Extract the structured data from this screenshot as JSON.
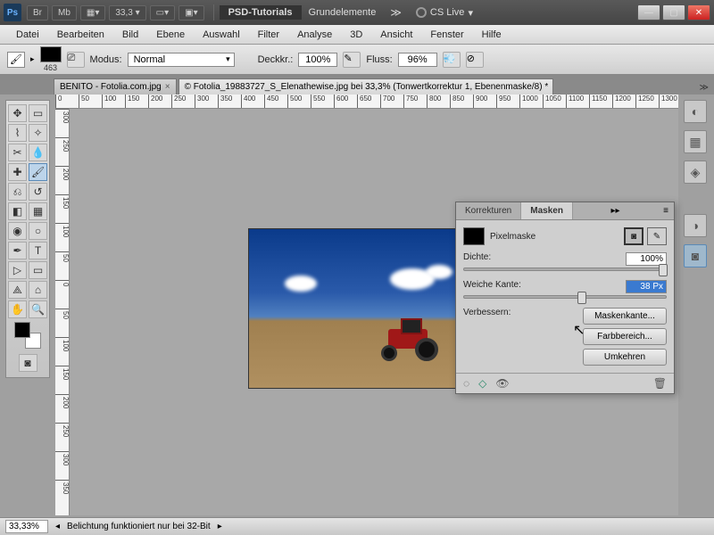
{
  "titlebar": {
    "zoom": "33,3",
    "psd_tutorials": "PSD-Tutorials",
    "grundelemente": "Grundelemente",
    "cslive": "CS Live"
  },
  "menu": [
    "Datei",
    "Bearbeiten",
    "Bild",
    "Ebene",
    "Auswahl",
    "Filter",
    "Analyse",
    "3D",
    "Ansicht",
    "Fenster",
    "Hilfe"
  ],
  "options": {
    "swatch_label": "463",
    "modus_label": "Modus:",
    "modus_value": "Normal",
    "deckk_label": "Deckkr.:",
    "deckk_value": "100%",
    "fluss_label": "Fluss:",
    "fluss_value": "96%"
  },
  "tabs": {
    "t1": "BENITO - Fotolia.com.jpg",
    "t2": "© Fotolia_19883727_S_Elenathewise.jpg bei 33,3% (Tonwertkorrektur 1, Ebenenmaske/8) *"
  },
  "ruler_top": [
    "0",
    "50",
    "100",
    "150",
    "200",
    "250",
    "300",
    "350",
    "400",
    "450",
    "500",
    "550",
    "600",
    "650",
    "700",
    "750",
    "800",
    "850",
    "900",
    "950",
    "1000",
    "1050",
    "1100",
    "1150",
    "1200",
    "1250",
    "1300"
  ],
  "ruler_left": [
    "300",
    "250",
    "200",
    "150",
    "100",
    "50",
    "0",
    "50",
    "100",
    "150",
    "200",
    "250",
    "300",
    "350"
  ],
  "masks_panel": {
    "tab1": "Korrekturen",
    "tab2": "Masken",
    "pixelmaske": "Pixelmaske",
    "dichte_label": "Dichte:",
    "dichte_value": "100%",
    "weiche_label": "Weiche Kante:",
    "weiche_value": "38 Px",
    "verbessern_label": "Verbessern:",
    "btn_maskenkante": "Maskenkante...",
    "btn_farbbereich": "Farbbereich...",
    "btn_umkehren": "Umkehren"
  },
  "statusbar": {
    "zoom": "33,33%",
    "msg": "Belichtung funktioniert nur bei 32-Bit"
  }
}
